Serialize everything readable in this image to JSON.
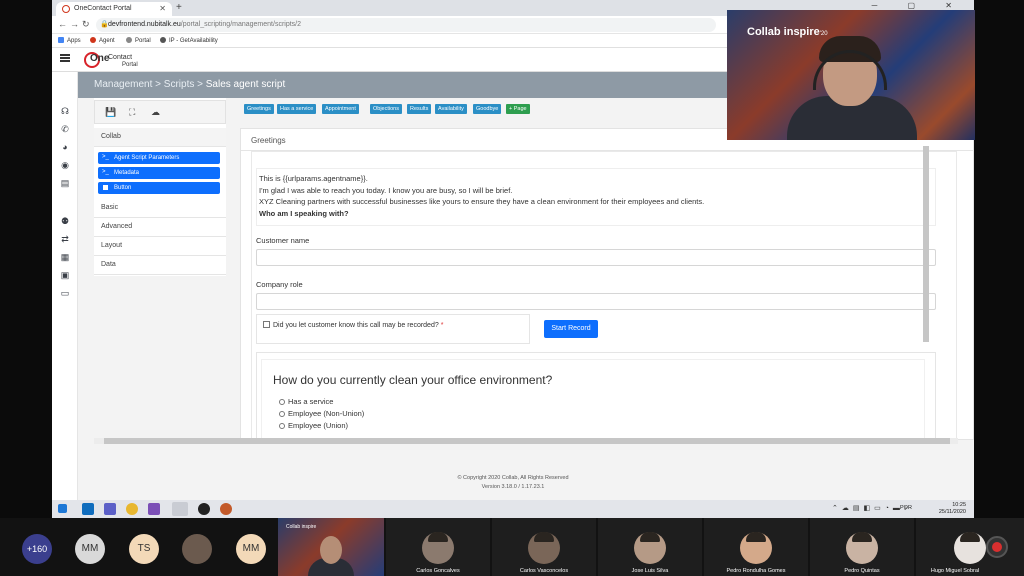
{
  "browser": {
    "tab_title": "OneContact Portal",
    "new_tab": "+",
    "window_controls": "─ ▢ ✕",
    "url_host": "devfrontend.nubitalk.eu",
    "url_path": "/portal_scripting/management/scripts/2",
    "bookmarks": [
      {
        "label": "Apps",
        "color": "#4285f4"
      },
      {
        "label": "Agent",
        "color": "#d0361c"
      },
      {
        "label": "Portal",
        "color": "#888888"
      },
      {
        "label": "IP - GetAvailability",
        "color": "#555555"
      }
    ]
  },
  "app": {
    "logo_one": "One",
    "logo_contact": "Contact",
    "logo_portal": "Portal",
    "breadcrumb": {
      "part1": "Management",
      "sep1": " > ",
      "part2": "Scripts",
      "sep2": " > ",
      "current": "Sales agent script"
    }
  },
  "left_panel": {
    "group_title": "Collab",
    "components": [
      {
        "label": "Agent Script Parameters",
        "icon": ">_"
      },
      {
        "label": "Metadata",
        "icon": ">_"
      },
      {
        "label": "Button",
        "icon": "square"
      }
    ],
    "sections": [
      "Basic",
      "Advanced",
      "Layout",
      "Data"
    ]
  },
  "page_buttons": [
    {
      "label": "Greetings"
    },
    {
      "label": "Has a service"
    },
    {
      "label": "Appointment"
    },
    {
      "label": "Objections"
    },
    {
      "label": "Results"
    },
    {
      "label": "Availability"
    },
    {
      "label": "Goodbye"
    },
    {
      "label": "+ Page"
    }
  ],
  "main": {
    "section_title": "Greetings",
    "greeting_lines": [
      "This is {{urlparams.agentname}}.",
      "I'm glad I was able to reach you today. I know you are busy, so I will be brief.",
      "XYZ Cleaning partners with successful businesses like yours to ensure they have a clean environment for their employees and clients."
    ],
    "greeting_bold": "Who am I speaking with?",
    "customer_name_label": "Customer name",
    "company_role_label": "Company role",
    "consent_label": "Did you let customer know this call may be recorded?",
    "required_mark": "*",
    "start_record": "Start Record",
    "question": "How do you currently clean your office environment?",
    "options": [
      "Has a service",
      "Employee (Non-Union)",
      "Employee (Union)"
    ]
  },
  "footer": {
    "copyright": "© Copyright 2020 Collab, All Rights Reserved",
    "version": "Version 3.18.0 / 1.17.23.1"
  },
  "taskbar": {
    "lang": "POR",
    "time": "10:25",
    "date": "25/11/2020"
  },
  "webcam": {
    "brand": "Collab inspire",
    "brand_year": "'20"
  },
  "meeting": {
    "overflow_count": "+160",
    "avatars": [
      {
        "initials": "MM",
        "color": "#d9d9d9"
      },
      {
        "initials": "TS",
        "color": "#f3d9b8"
      },
      {
        "initials": "MM",
        "color": "#f3d9b8"
      }
    ],
    "self_brand": "Collab inspire",
    "participants": [
      "Carlos Goncalves",
      "Carlos Vasconcelos",
      "Jose Luis Silva",
      "Pedro Rondulha Gomes",
      "Pedro Quintas",
      "Hugo Miguel Sobral"
    ]
  }
}
